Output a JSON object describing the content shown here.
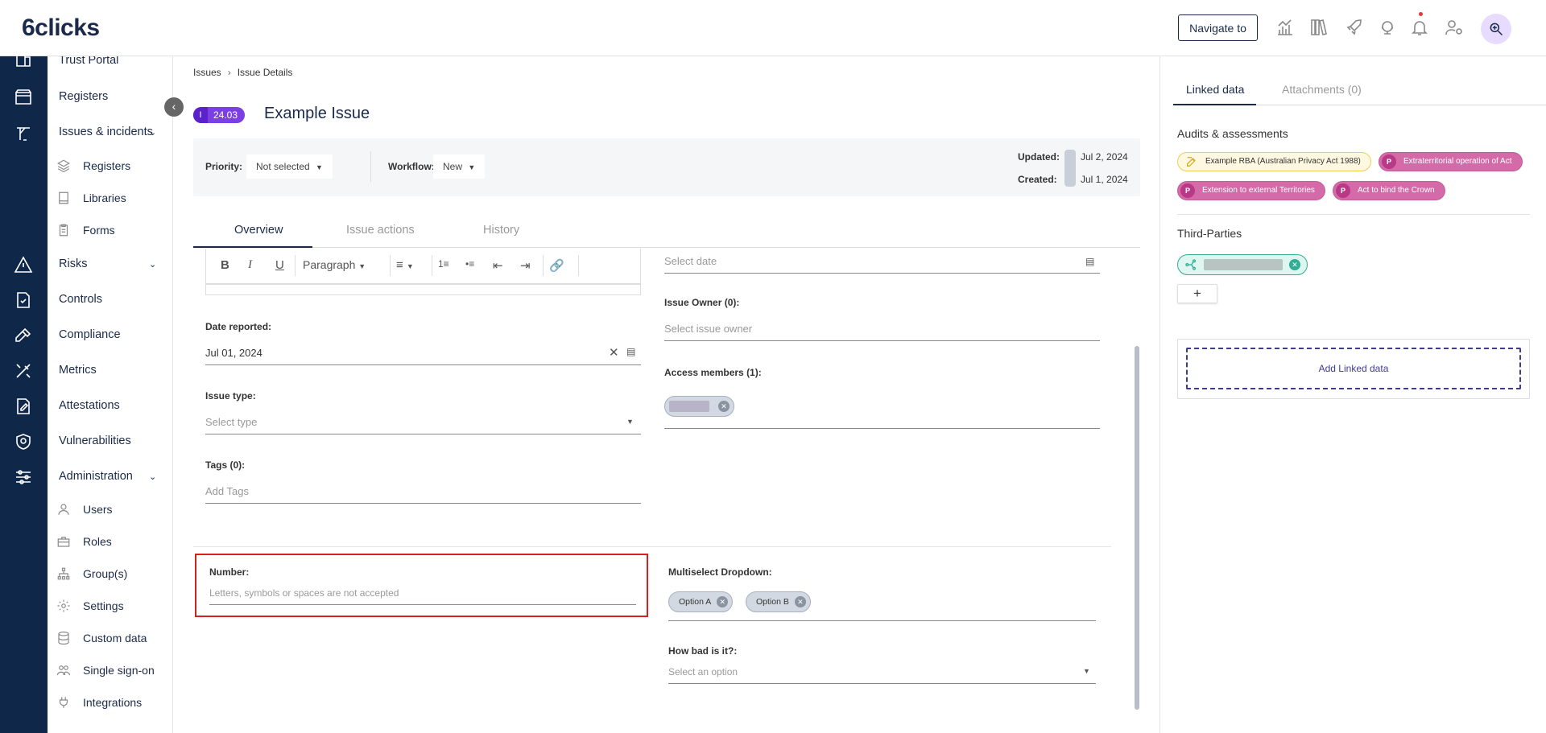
{
  "app": {
    "logo": "6clicks",
    "navigate_label": "Navigate to"
  },
  "sidebar": {
    "items": [
      {
        "label": "Trust Portal"
      },
      {
        "label": "Registers"
      },
      {
        "label": "Issues & incidents"
      },
      {
        "label": "Registers"
      },
      {
        "label": "Libraries"
      },
      {
        "label": "Forms"
      },
      {
        "label": "Risks"
      },
      {
        "label": "Controls"
      },
      {
        "label": "Compliance"
      },
      {
        "label": "Metrics"
      },
      {
        "label": "Attestations"
      },
      {
        "label": "Vulnerabilities"
      },
      {
        "label": "Administration"
      },
      {
        "label": "Users"
      },
      {
        "label": "Roles"
      },
      {
        "label": "Group(s)"
      },
      {
        "label": "Settings"
      },
      {
        "label": "Custom data"
      },
      {
        "label": "Single sign-on"
      },
      {
        "label": "Integrations"
      }
    ]
  },
  "breadcrumb": {
    "parent": "Issues",
    "current": "Issue Details"
  },
  "issue": {
    "id_prefix": "I",
    "id": "24.03",
    "title": "Example Issue"
  },
  "meta": {
    "priority_label": "Priority:",
    "priority_value": "Not selected",
    "workflow_label": "Workflow:",
    "workflow_value": "New",
    "updated_label": "Updated:",
    "updated_value": "Jul 2, 2024",
    "created_label": "Created:",
    "created_value": "Jul 1, 2024"
  },
  "tabs": [
    {
      "label": "Overview"
    },
    {
      "label": "Issue actions"
    },
    {
      "label": "History"
    }
  ],
  "editor": {
    "paragraph_label": "Paragraph"
  },
  "form": {
    "date_placeholder": "Select date",
    "date_reported_label": "Date reported:",
    "date_reported_value": "Jul 01, 2024",
    "issue_type_label": "Issue type:",
    "issue_type_placeholder": "Select type",
    "tags_label": "Tags (0):",
    "tags_placeholder": "Add Tags",
    "owner_label": "Issue Owner (0):",
    "owner_placeholder": "Select issue owner",
    "access_label": "Access members (1):",
    "number_label": "Number:",
    "number_placeholder": "Letters, symbols or spaces are not accepted",
    "multiselect_label": "Multiselect Dropdown:",
    "multiselect_options": [
      "Option A",
      "Option B"
    ],
    "how_bad_label": "How bad is it?:",
    "how_bad_placeholder": "Select an option"
  },
  "right_panel": {
    "tabs": [
      {
        "label": "Linked data"
      },
      {
        "label": "Attachments (0)"
      }
    ],
    "audits_title": "Audits & assessments",
    "audits": [
      {
        "label": "Example RBA (Australian Privacy Act 1988)"
      },
      {
        "label": "Extraterritorial operation of Act",
        "badge": "P"
      },
      {
        "label": "Extension to external Territories",
        "badge": "P"
      },
      {
        "label": "Act to bind the Crown",
        "badge": "P"
      }
    ],
    "third_parties_title": "Third-Parties",
    "add_symbol": "+",
    "add_linked_label": "Add Linked data"
  },
  "colors": {
    "rail": "#0f2748",
    "accent": "#1b2a4a",
    "badge": "#7b3fe4",
    "highlight": "#d32020",
    "teal": "#2fae95",
    "policy": "#d46aa8"
  }
}
